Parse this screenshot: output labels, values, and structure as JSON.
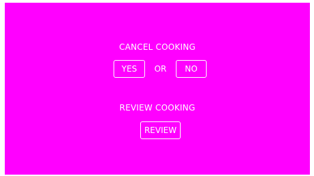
{
  "colors": {
    "background": "#ff00ff",
    "foreground": "#ffffff"
  },
  "cancel": {
    "title": "CANCEL COOKING",
    "yes_label": "YES",
    "or_label": "OR",
    "no_label": "NO"
  },
  "review": {
    "title": "REVIEW COOKING",
    "button_label": "REVIEW"
  }
}
